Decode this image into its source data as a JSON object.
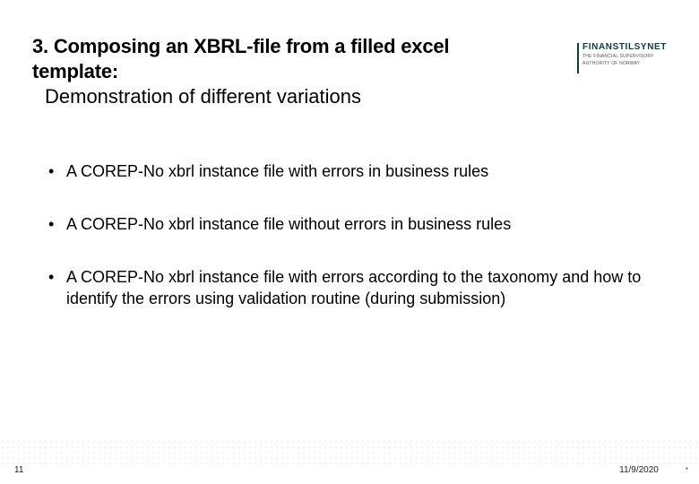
{
  "header": {
    "title_bold": "3. Composing an XBRL-file from a filled excel template:",
    "title_sub": "Demonstration of different variations"
  },
  "logo": {
    "name": "FINANSTILSYNET",
    "tagline1": "THE FINANCIAL SUPERVISORY",
    "tagline2": "AUTHORITY OF NORWAY"
  },
  "bullets": [
    "A COREP-No xbrl instance file with errors in business rules",
    "A COREP-No xbrl instance file without errors in business rules",
    "A COREP-No xbrl instance file with errors according to the taxonomy and how to identify the errors using validation routine (during submission)"
  ],
  "footer": {
    "page": "11",
    "date": "11/9/2020",
    "marker": "*"
  }
}
